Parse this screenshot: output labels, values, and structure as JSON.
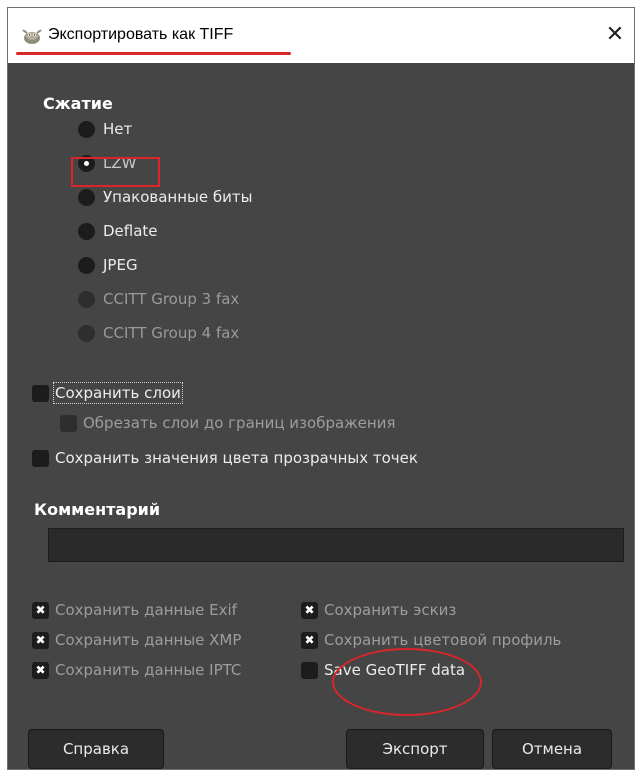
{
  "window": {
    "title": "Экспортировать как TIFF",
    "close_glyph": "✕"
  },
  "compression": {
    "heading": "Сжатие",
    "options": [
      {
        "label": "Нет",
        "selected": false,
        "enabled": true
      },
      {
        "label": "LZW",
        "selected": true,
        "enabled": true
      },
      {
        "label": "Упакованные биты",
        "selected": false,
        "enabled": true
      },
      {
        "label": "Deflate",
        "selected": false,
        "enabled": true
      },
      {
        "label": "JPEG",
        "selected": false,
        "enabled": true
      },
      {
        "label": "CCITT Group 3 fax",
        "selected": false,
        "enabled": false
      },
      {
        "label": "CCITT Group 4 fax",
        "selected": false,
        "enabled": false
      }
    ]
  },
  "layers": {
    "save_layers": {
      "label": "Сохранить слои",
      "checked": false
    },
    "crop_layers": {
      "label": "Обрезать слои до границ изображения",
      "checked": false
    },
    "save_transparent": {
      "label": "Сохранить значения цвета прозрачных точек",
      "checked": false
    }
  },
  "comment": {
    "heading": "Комментарий",
    "value": ""
  },
  "metadata": {
    "exif": {
      "label": "Сохранить данные Exif",
      "checked": true
    },
    "xmp": {
      "label": "Сохранить данные XMP",
      "checked": true
    },
    "iptc": {
      "label": "Сохранить данные IPTC",
      "checked": true
    },
    "thumbnail": {
      "label": "Сохранить эскиз",
      "checked": true
    },
    "color_profile": {
      "label": "Сохранить цветовой профиль",
      "checked": true
    },
    "geotiff": {
      "label": "Save GeoTIFF data",
      "checked": false
    }
  },
  "buttons": {
    "help": "Справка",
    "export": "Экспорт",
    "cancel": "Отмена"
  },
  "colors": {
    "dialog_bg": "#454545",
    "annotation_red": "#d9262b"
  }
}
